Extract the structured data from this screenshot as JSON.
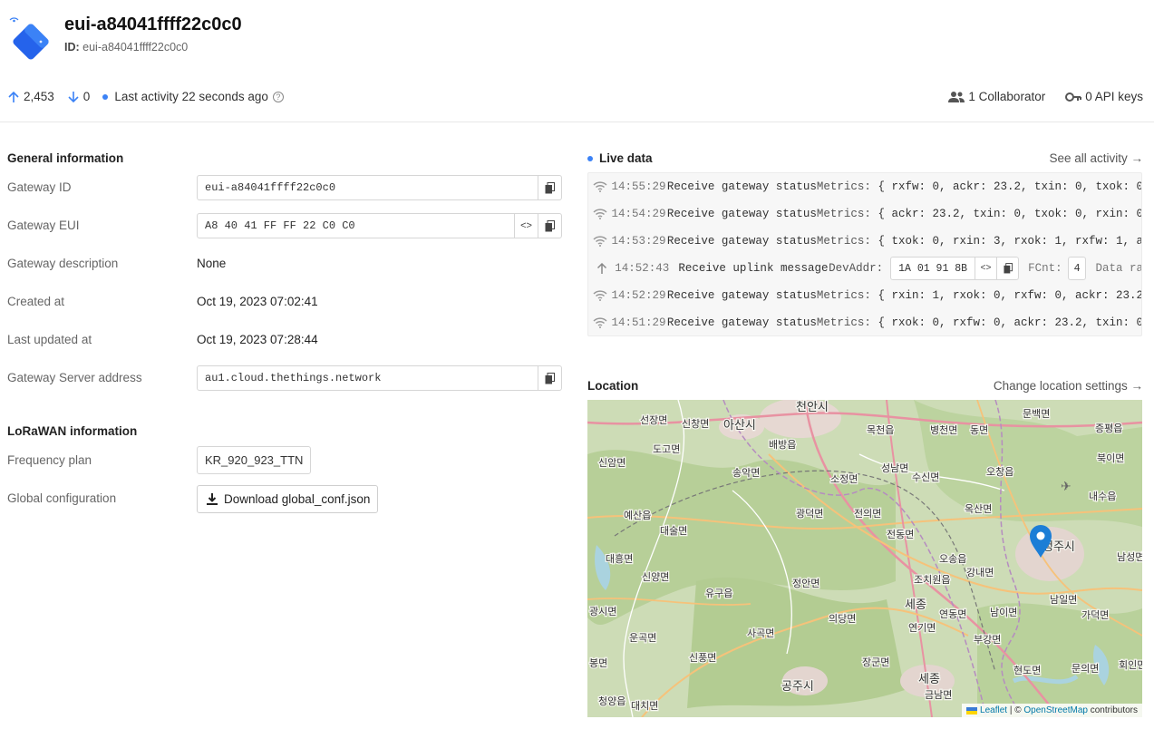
{
  "header": {
    "title": "eui-a84041ffff22c0c0",
    "id_label": "ID:",
    "id_value": "eui-a84041ffff22c0c0",
    "uplink_count": "2,453",
    "downlink_count": "0",
    "last_activity": "Last activity 22 seconds ago",
    "collaborators": "1 Collaborator",
    "api_keys": "0 API keys"
  },
  "general": {
    "title": "General information",
    "gateway_id_label": "Gateway ID",
    "gateway_id": "eui-a84041ffff22c0c0",
    "gateway_eui_label": "Gateway EUI",
    "gateway_eui": "A8 40 41 FF FF 22 C0 C0",
    "description_label": "Gateway description",
    "description": "None",
    "created_label": "Created at",
    "created": "Oct 19, 2023 07:02:41",
    "updated_label": "Last updated at",
    "updated": "Oct 19, 2023 07:28:44",
    "server_label": "Gateway Server address",
    "server": "au1.cloud.thethings.network"
  },
  "lorawan": {
    "title": "LoRaWAN information",
    "freq_label": "Frequency plan",
    "freq": "KR_920_923_TTN",
    "global_label": "Global configuration",
    "download_label": "Download global_conf.json"
  },
  "live": {
    "title": "Live data",
    "see_all": "See all activity →",
    "events": [
      {
        "time": "14:55:29",
        "type": "Receive gateway status",
        "label": "Metrics:",
        "body": "{ rxfw: 0, ackr: 23.2, txin: 0, txok: 0"
      },
      {
        "time": "14:54:29",
        "type": "Receive gateway status",
        "label": "Metrics:",
        "body": "{ ackr: 23.2, txin: 0, txok: 0, rxin: 0"
      },
      {
        "time": "14:53:29",
        "type": "Receive gateway status",
        "label": "Metrics:",
        "body": "{ txok: 0, rxin: 3, rxok: 1, rxfw: 1, a"
      },
      {
        "time": "14:52:43",
        "type": "Receive uplink message",
        "label": "DevAddr:",
        "body": "1A 01 91 8B",
        "fcnt_label": "FCnt:",
        "fcnt": "4",
        "extra": "Data ra"
      },
      {
        "time": "14:52:29",
        "type": "Receive gateway status",
        "label": "Metrics:",
        "body": "{ rxin: 1, rxok: 0, rxfw: 0, ackr: 23.2"
      },
      {
        "time": "14:51:29",
        "type": "Receive gateway status",
        "label": "Metrics:",
        "body": "{ rxok: 0, rxfw: 0, ackr: 23.2, txin: 0"
      }
    ]
  },
  "location": {
    "title": "Location",
    "change_link": "Change location settings →",
    "attribution_leaflet": "Leaflet",
    "attribution_sep": "| ©",
    "attribution_osm": "OpenStreetMap",
    "attribution_tail": "contributors",
    "places": [
      "천안시",
      "아산시",
      "신창면",
      "선장면",
      "도고면",
      "배방읍",
      "목천읍",
      "병천면",
      "동면",
      "문백면",
      "증평읍",
      "북이면",
      "신암면",
      "송악면",
      "소정면",
      "성남면",
      "수신면",
      "오창읍",
      "내수읍",
      "예산읍",
      "대술면",
      "광덕면",
      "전의면",
      "옥산면",
      "청주시",
      "대흥면",
      "신양면",
      "전동면",
      "오송읍",
      "강내면",
      "남성면",
      "유구읍",
      "정안면",
      "조치원읍",
      "세종",
      "남일면",
      "가덕면",
      "광시면",
      "운곡면",
      "사곡면",
      "의당면",
      "연동면",
      "남이면",
      "연기면",
      "신풍면",
      "장군면",
      "부강면",
      "봉면",
      "공주시",
      "세종",
      "현도면",
      "문의면",
      "청양읍",
      "대치면",
      "금남면",
      "회인면"
    ],
    "colors": {
      "marker": "#1c7ed6"
    }
  }
}
